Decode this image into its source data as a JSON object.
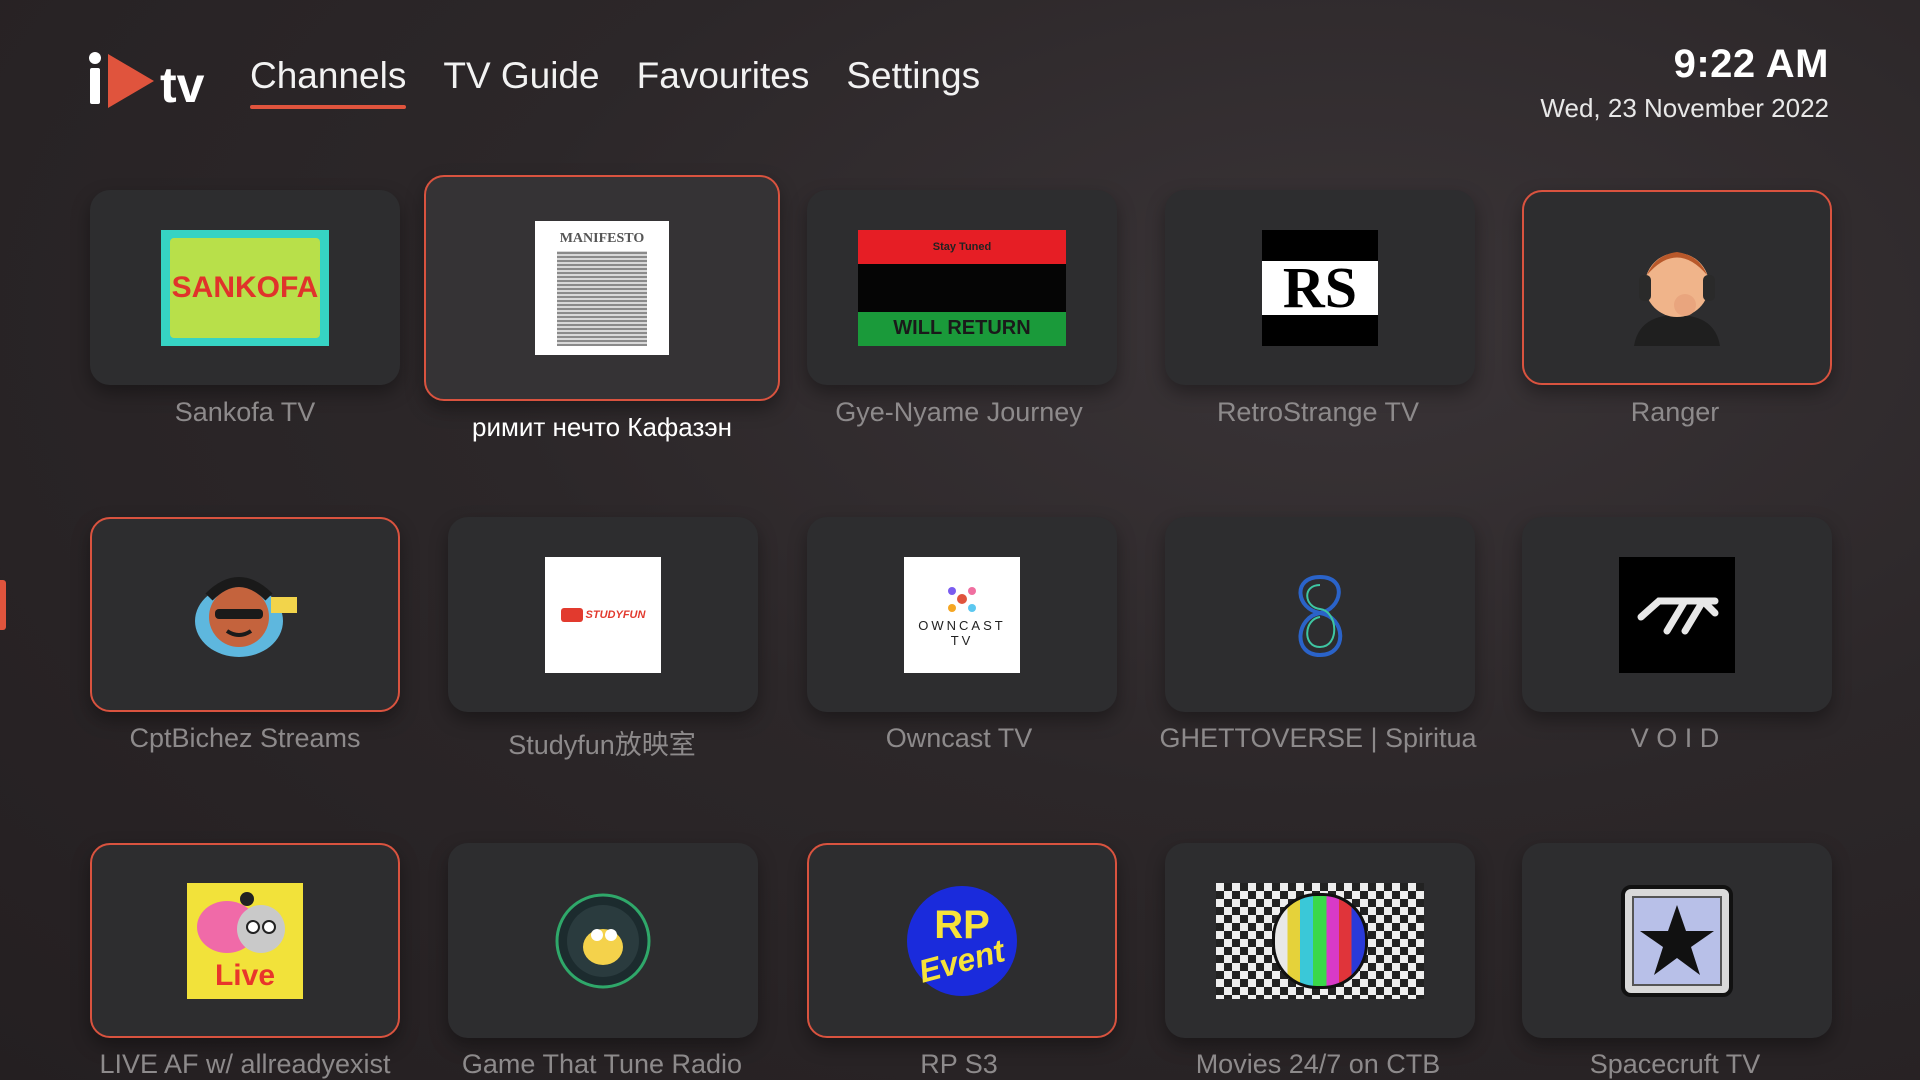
{
  "app": {
    "logo_text": "tv"
  },
  "nav": {
    "tabs": [
      "Channels",
      "TV Guide",
      "Favourites",
      "Settings"
    ],
    "active": "Channels"
  },
  "clock": {
    "time": "9:22 AM",
    "date": "Wed, 23 November 2022"
  },
  "thumbnails": {
    "sankofa": "SANKOFA",
    "manifesto": "MANIFESTO",
    "gyenyame_top": "Stay Tuned",
    "gyenyame_bottom": "WILL RETURN",
    "retrostrange": "RS",
    "studyfun": "STUDYFUN",
    "owncast_line1": "OWNCAST",
    "owncast_line2": "TV",
    "live": "Live",
    "rp_line1": "RP",
    "rp_line2": "Event"
  },
  "channels": [
    {
      "name": "Sankofa TV"
    },
    {
      "name": "римит нечто   Кафазэн"
    },
    {
      "name": "Gye-Nyame Journey"
    },
    {
      "name": "RetroStrange TV"
    },
    {
      "name": "Ranger"
    },
    {
      "name": "CptBichez Streams"
    },
    {
      "name": "Studyfun放映室"
    },
    {
      "name": "Owncast TV"
    },
    {
      "name": "GHETTOVERSE | Spiritua"
    },
    {
      "name": "V O I D"
    },
    {
      "name": "LIVE AF w/ allreadyexist"
    },
    {
      "name": "Game That Tune Radio"
    },
    {
      "name": "RP S3"
    },
    {
      "name": "Movies 24/7 on CTB"
    },
    {
      "name": "Spacecruft TV"
    }
  ],
  "colors": {
    "accent": "#e0543d",
    "card": "#2d2d2f",
    "label": "#8d8a8b"
  }
}
